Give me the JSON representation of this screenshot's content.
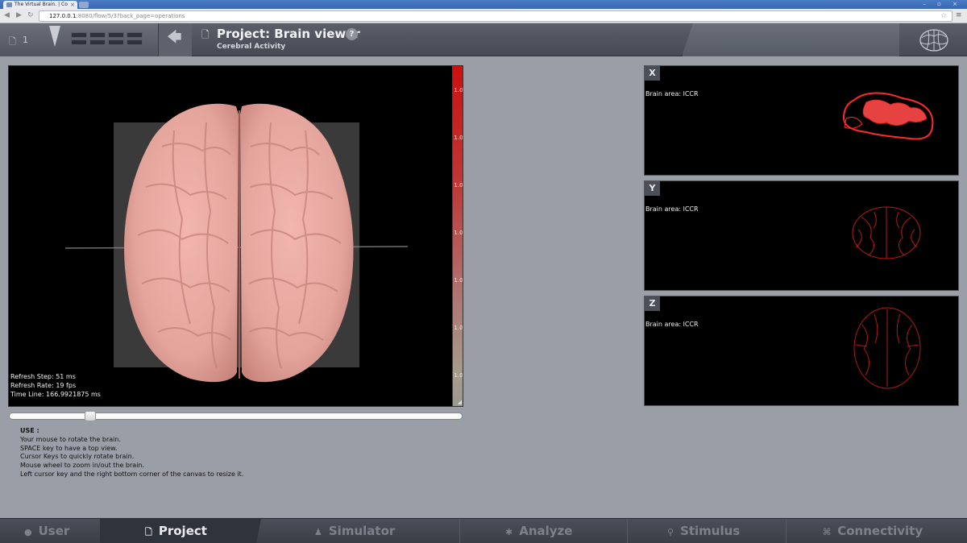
{
  "browser": {
    "tab_title": "The Virtual Brain. | Co",
    "url_host": "127.0.0.1",
    "url_path": ":8080/flow/5/3?back_page=operations"
  },
  "header": {
    "operation_count": "1",
    "project_title": "Project: Brain viewer",
    "subtitle": "Cerebral Activity",
    "help_label": "?"
  },
  "viewer": {
    "colorbar_labels": [
      "1.0",
      "1.0",
      "1.0",
      "1.0",
      "1.0",
      "1.0",
      "1.0"
    ],
    "refresh_step": "Refresh Step: 51 ms",
    "refresh_rate": "Refresh Rate: 19 fps",
    "time_line": "Time Line: 166.9921875 ms",
    "time_slider_value": 0.17
  },
  "usage": {
    "title": "USE :",
    "lines": [
      "Your mouse to rotate the brain.",
      "SPACE key to have a top view.",
      "Cursor Keys to quickly rotate brain.",
      "Mouse wheel to zoom in/out the brain.",
      "Left cursor key and the right bottom corner of the canvas to resize it."
    ]
  },
  "projections": [
    {
      "axis": "X",
      "area": "Brain area: lCCR"
    },
    {
      "axis": "Y",
      "area": "Brain area: lCCR"
    },
    {
      "axis": "Z",
      "area": "Brain area: lCCR"
    }
  ],
  "footer": {
    "items": [
      {
        "label": "User",
        "icon": "user-icon"
      },
      {
        "label": "Project",
        "icon": "document-icon"
      },
      {
        "label": "Simulator",
        "icon": "simulator-icon"
      },
      {
        "label": "Analyze",
        "icon": "gear-icon"
      },
      {
        "label": "Stimulus",
        "icon": "pin-icon"
      },
      {
        "label": "Connectivity",
        "icon": "connectivity-icon"
      }
    ]
  },
  "colors": {
    "brain": "#e8a8a0",
    "colorbar_top": "#cc1010",
    "header_bg": "#50555f",
    "footer_active": "#2f333b"
  }
}
